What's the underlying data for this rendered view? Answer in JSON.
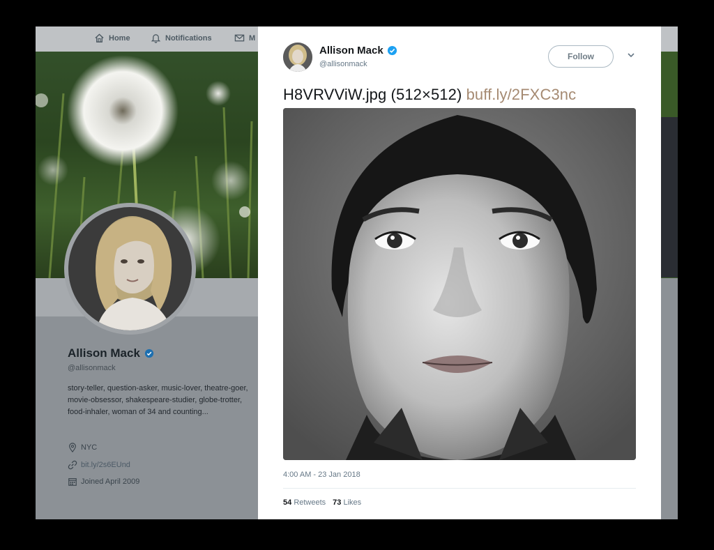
{
  "nav": {
    "home": "Home",
    "notifications": "Notifications",
    "messages": "M"
  },
  "profile": {
    "name": "Allison Mack",
    "handle": "@allisonmack",
    "bio": "story-teller, question-asker, music-lover, theatre-goer, movie-obsessor, shakespeare-studier, globe-trotter, food-inhaler, woman of 34 and counting...",
    "location": "NYC",
    "link": "bit.ly/2s6EUnd",
    "joined": "Joined April 2009"
  },
  "tweet": {
    "name": "Allison Mack",
    "handle": "@allisonmack",
    "follow_label": "Follow",
    "text_main": "H8VRVViW.jpg (512×512) ",
    "text_link": "buff.ly/2FXC3nc",
    "timestamp": "4:00 AM - 23 Jan 2018",
    "retweets_count": "54",
    "retweets_label": "Retweets",
    "likes_count": "73",
    "likes_label": "Likes"
  },
  "colors": {
    "verified": "#1da1f2",
    "link": "#a58a72",
    "overlay": "#8c9196"
  },
  "icons": [
    "home-icon",
    "bell-icon",
    "mail-icon",
    "verified-badge-icon",
    "location-icon",
    "link-icon",
    "calendar-icon",
    "chevron-down-icon"
  ]
}
